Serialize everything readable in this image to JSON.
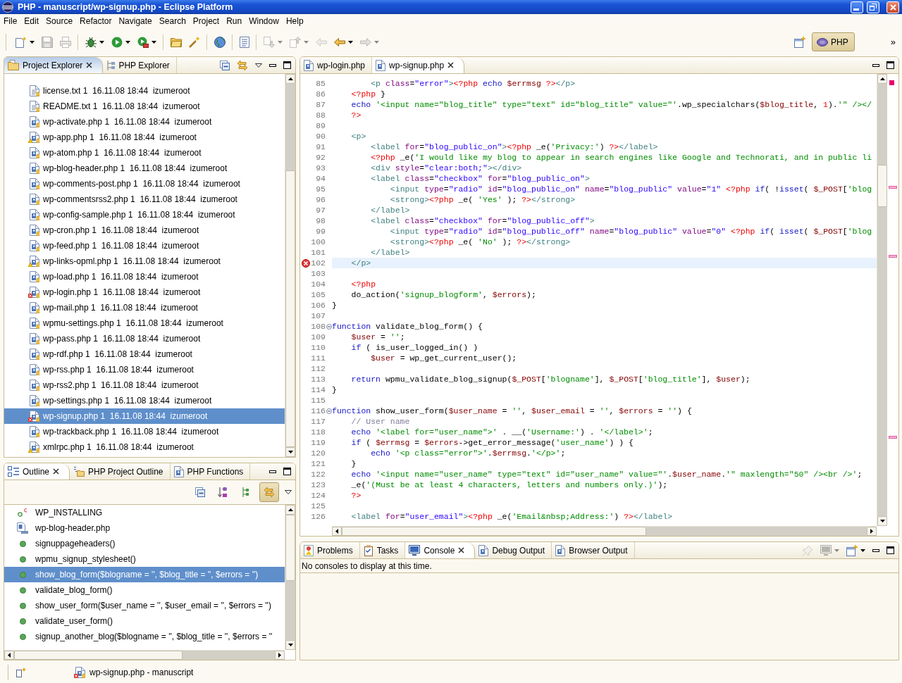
{
  "window": {
    "title": "PHP - manuscript/wp-signup.php - Eclipse Platform"
  },
  "menu": [
    "File",
    "Edit",
    "Source",
    "Refactor",
    "Navigate",
    "Search",
    "Project",
    "Run",
    "Window",
    "Help"
  ],
  "toolbar": {
    "buttons": [
      {
        "disabled": false,
        "dropdown": true
      },
      {
        "disabled": true,
        "dropdown": false
      },
      {
        "disabled": true,
        "dropdown": false
      },
      {
        "disabled": false,
        "dropdown": true
      },
      {
        "disabled": false,
        "dropdown": true
      },
      {
        "disabled": false,
        "dropdown": true
      },
      {
        "disabled": false,
        "dropdown": false
      },
      {
        "disabled": false,
        "dropdown": false
      },
      {
        "disabled": false,
        "dropdown": false
      },
      {
        "disabled": false,
        "dropdown": false
      },
      {
        "disabled": true,
        "dropdown": true
      },
      {
        "disabled": true,
        "dropdown": true
      },
      {
        "disabled": true,
        "dropdown": false
      },
      {
        "disabled": false,
        "dropdown": true
      },
      {
        "disabled": true,
        "dropdown": true
      }
    ],
    "perspectives": [
      {
        "label": "PHP",
        "selected": true
      }
    ],
    "overflow": "»"
  },
  "project_explorer": {
    "active": true,
    "tabs": [
      {
        "label": "Project Explorer",
        "selected": true
      },
      {
        "label": "PHP Explorer",
        "selected": false
      }
    ],
    "items": [
      {
        "name": "license.txt 1  16.11.08 18:44  izumeroot",
        "kind": "text",
        "selected": false
      },
      {
        "name": "README.txt 1  16.11.08 18:44  izumeroot",
        "kind": "text",
        "selected": false
      },
      {
        "name": "wp-activate.php 1  16.11.08 18:44  izumeroot",
        "kind": "php",
        "selected": false
      },
      {
        "name": "wp-app.php 1  16.11.08 18:44  izumeroot",
        "kind": "php-warning",
        "selected": false
      },
      {
        "name": "wp-atom.php 1  16.11.08 18:44  izumeroot",
        "kind": "php",
        "selected": false
      },
      {
        "name": "wp-blog-header.php 1  16.11.08 18:44  izumeroot",
        "kind": "php",
        "selected": false
      },
      {
        "name": "wp-comments-post.php 1  16.11.08 18:44  izumeroot",
        "kind": "php",
        "selected": false
      },
      {
        "name": "wp-commentsrss2.php 1  16.11.08 18:44  izumeroot",
        "kind": "php",
        "selected": false
      },
      {
        "name": "wp-config-sample.php 1  16.11.08 18:44  izumeroot",
        "kind": "php",
        "selected": false
      },
      {
        "name": "wp-cron.php 1  16.11.08 18:44  izumeroot",
        "kind": "php",
        "selected": false
      },
      {
        "name": "wp-feed.php 1  16.11.08 18:44  izumeroot",
        "kind": "php",
        "selected": false
      },
      {
        "name": "wp-links-opml.php 1  16.11.08 18:44  izumeroot",
        "kind": "php-warning",
        "selected": false
      },
      {
        "name": "wp-load.php 1  16.11.08 18:44  izumeroot",
        "kind": "php",
        "selected": false
      },
      {
        "name": "wp-login.php 1  16.11.08 18:44  izumeroot",
        "kind": "php-error",
        "selected": false
      },
      {
        "name": "wp-mail.php 1  16.11.08 18:44  izumeroot",
        "kind": "php",
        "selected": false
      },
      {
        "name": "wpmu-settings.php 1  16.11.08 18:44  izumeroot",
        "kind": "php",
        "selected": false
      },
      {
        "name": "wp-pass.php 1  16.11.08 18:44  izumeroot",
        "kind": "php",
        "selected": false
      },
      {
        "name": "wp-rdf.php 1  16.11.08 18:44  izumeroot",
        "kind": "php",
        "selected": false
      },
      {
        "name": "wp-rss.php 1  16.11.08 18:44  izumeroot",
        "kind": "php",
        "selected": false
      },
      {
        "name": "wp-rss2.php 1  16.11.08 18:44  izumeroot",
        "kind": "php",
        "selected": false
      },
      {
        "name": "wp-settings.php 1  16.11.08 18:44  izumeroot",
        "kind": "php",
        "selected": false
      },
      {
        "name": "wp-signup.php 1  16.11.08 18:44  izumeroot",
        "kind": "php-error",
        "selected": true
      },
      {
        "name": "wp-trackback.php 1  16.11.08 18:44  izumeroot",
        "kind": "php",
        "selected": false
      },
      {
        "name": "xmlrpc.php 1  16.11.08 18:44  izumeroot",
        "kind": "php-warning",
        "selected": false
      }
    ]
  },
  "outline": {
    "active": false,
    "tabs": [
      {
        "label": "Outline",
        "selected": true
      },
      {
        "label": "PHP Project Outline",
        "selected": false
      },
      {
        "label": "PHP Functions",
        "selected": false
      }
    ],
    "toolbar": [
      {
        "pressed": false
      },
      {
        "pressed": false
      },
      {
        "pressed": false
      },
      {
        "pressed": true
      }
    ],
    "items": [
      {
        "label": "WP_INSTALLING",
        "kind": "constant",
        "selected": false
      },
      {
        "label": "wp-blog-header.php",
        "kind": "include",
        "selected": false
      },
      {
        "label": "signuppageheaders()",
        "kind": "function",
        "selected": false
      },
      {
        "label": "wpmu_signup_stylesheet()",
        "kind": "function",
        "selected": false
      },
      {
        "label": "show_blog_form($blogname = '', $blog_title = '', $errors = '')",
        "kind": "function",
        "selected": true
      },
      {
        "label": "validate_blog_form()",
        "kind": "function",
        "selected": false
      },
      {
        "label": "show_user_form($user_name = '', $user_email = '', $errors = '')",
        "kind": "function",
        "selected": false
      },
      {
        "label": "validate_user_form()",
        "kind": "function",
        "selected": false
      },
      {
        "label": "signup_another_blog($blogname = '', $blog_title = '', $errors = ''",
        "kind": "function",
        "selected": false
      }
    ]
  },
  "editor": {
    "active": false,
    "tabs": [
      {
        "label": "wp-login.php",
        "selected": false
      },
      {
        "label": "wp-signup.php",
        "selected": true
      }
    ],
    "lines": [
      {
        "no": "85",
        "current": false,
        "error": false,
        "folding": false,
        "code": [
          {
            "kind": "tag",
            "text": "        <p "
          },
          {
            "kind": "attr",
            "text": "class"
          },
          {
            "kind": "plain",
            "text": "="
          },
          {
            "kind": "value",
            "text": "\"error\""
          },
          {
            "kind": "tag",
            "text": ">"
          },
          {
            "kind": "php",
            "text": "<?php "
          },
          {
            "kind": "keyword",
            "text": "echo "
          },
          {
            "kind": "variable",
            "text": "$errmsg "
          },
          {
            "kind": "php",
            "text": "?>"
          },
          {
            "kind": "tag",
            "text": "</p>"
          }
        ]
      },
      {
        "no": "86",
        "current": false,
        "error": false,
        "folding": false,
        "code": [
          {
            "kind": "php",
            "text": "    <?php"
          },
          {
            "kind": "plain",
            "text": " }"
          }
        ]
      },
      {
        "no": "87",
        "current": false,
        "error": false,
        "folding": false,
        "code": [
          {
            "kind": "keyword",
            "text": "    echo "
          },
          {
            "kind": "string",
            "text": "'<input name=\"blog_title\" type=\"text\" id=\"blog_title\" value=\"'"
          },
          {
            "kind": "plain",
            "text": ".wp_specialchars("
          },
          {
            "kind": "variable",
            "text": "$blog_title"
          },
          {
            "kind": "plain",
            "text": ", "
          },
          {
            "kind": "number",
            "text": "1"
          },
          {
            "kind": "plain",
            "text": ")."
          },
          {
            "kind": "string",
            "text": "'\" /></"
          }
        ]
      },
      {
        "no": "88",
        "current": false,
        "error": false,
        "folding": false,
        "code": [
          {
            "kind": "php",
            "text": "    ?>"
          }
        ]
      },
      {
        "no": "89",
        "current": false,
        "error": false,
        "folding": false
      },
      {
        "no": "90",
        "current": false,
        "error": false,
        "folding": false,
        "code": [
          {
            "kind": "tag",
            "text": "    <p>"
          }
        ]
      },
      {
        "no": "91",
        "current": false,
        "error": false,
        "folding": false,
        "code": [
          {
            "kind": "tag",
            "text": "        <label "
          },
          {
            "kind": "attr",
            "text": "for"
          },
          {
            "kind": "plain",
            "text": "="
          },
          {
            "kind": "value",
            "text": "\"blog_public_on\""
          },
          {
            "kind": "tag",
            "text": ">"
          },
          {
            "kind": "php",
            "text": "<?php"
          },
          {
            "kind": "plain",
            "text": " _e("
          },
          {
            "kind": "string",
            "text": "'Privacy:'"
          },
          {
            "kind": "plain",
            "text": ") "
          },
          {
            "kind": "php",
            "text": "?>"
          },
          {
            "kind": "tag",
            "text": "</label>"
          }
        ]
      },
      {
        "no": "92",
        "current": false,
        "error": false,
        "folding": false,
        "code": [
          {
            "kind": "php",
            "text": "        <?php"
          },
          {
            "kind": "plain",
            "text": " _e("
          },
          {
            "kind": "string",
            "text": "'I would like my blog to appear in search engines like Google and Technorati, and in public li"
          }
        ]
      },
      {
        "no": "93",
        "current": false,
        "error": false,
        "folding": false,
        "code": [
          {
            "kind": "tag",
            "text": "        <div "
          },
          {
            "kind": "attr",
            "text": "style"
          },
          {
            "kind": "plain",
            "text": "="
          },
          {
            "kind": "value",
            "text": "\"clear:both;\""
          },
          {
            "kind": "tag",
            "text": "></div>"
          }
        ]
      },
      {
        "no": "94",
        "current": false,
        "error": false,
        "folding": false,
        "code": [
          {
            "kind": "tag",
            "text": "        <label "
          },
          {
            "kind": "attr",
            "text": "class"
          },
          {
            "kind": "plain",
            "text": "="
          },
          {
            "kind": "value",
            "text": "\"checkbox\" "
          },
          {
            "kind": "attr",
            "text": "for"
          },
          {
            "kind": "plain",
            "text": "="
          },
          {
            "kind": "value",
            "text": "\"blog_public_on\""
          },
          {
            "kind": "tag",
            "text": ">"
          }
        ]
      },
      {
        "no": "95",
        "current": false,
        "error": false,
        "folding": false,
        "code": [
          {
            "kind": "tag",
            "text": "            <input "
          },
          {
            "kind": "attr",
            "text": "type"
          },
          {
            "kind": "plain",
            "text": "="
          },
          {
            "kind": "value",
            "text": "\"radio\" "
          },
          {
            "kind": "attr",
            "text": "id"
          },
          {
            "kind": "plain",
            "text": "="
          },
          {
            "kind": "value",
            "text": "\"blog_public_on\" "
          },
          {
            "kind": "attr",
            "text": "name"
          },
          {
            "kind": "plain",
            "text": "="
          },
          {
            "kind": "value",
            "text": "\"blog_public\" "
          },
          {
            "kind": "attr",
            "text": "value"
          },
          {
            "kind": "plain",
            "text": "="
          },
          {
            "kind": "value",
            "text": "\"1\" "
          },
          {
            "kind": "php",
            "text": "<?php "
          },
          {
            "kind": "keyword",
            "text": "if"
          },
          {
            "kind": "plain",
            "text": "( !"
          },
          {
            "kind": "keyword",
            "text": "isset"
          },
          {
            "kind": "plain",
            "text": "( "
          },
          {
            "kind": "variable",
            "text": "$_POST"
          },
          {
            "kind": "plain",
            "text": "["
          },
          {
            "kind": "string",
            "text": "'blog"
          }
        ]
      },
      {
        "no": "96",
        "current": false,
        "error": false,
        "folding": false,
        "code": [
          {
            "kind": "tag",
            "text": "            <strong>"
          },
          {
            "kind": "php",
            "text": "<?php"
          },
          {
            "kind": "plain",
            "text": " _e( "
          },
          {
            "kind": "string",
            "text": "'Yes'"
          },
          {
            "kind": "plain",
            "text": " ); "
          },
          {
            "kind": "php",
            "text": "?>"
          },
          {
            "kind": "tag",
            "text": "</strong>"
          }
        ]
      },
      {
        "no": "97",
        "current": false,
        "error": false,
        "folding": false,
        "code": [
          {
            "kind": "tag",
            "text": "        </label>"
          }
        ]
      },
      {
        "no": "98",
        "current": false,
        "error": false,
        "folding": false,
        "code": [
          {
            "kind": "tag",
            "text": "        <label "
          },
          {
            "kind": "attr",
            "text": "class"
          },
          {
            "kind": "plain",
            "text": "="
          },
          {
            "kind": "value",
            "text": "\"checkbox\" "
          },
          {
            "kind": "attr",
            "text": "for"
          },
          {
            "kind": "plain",
            "text": "="
          },
          {
            "kind": "value",
            "text": "\"blog_public_off\""
          },
          {
            "kind": "tag",
            "text": ">"
          }
        ]
      },
      {
        "no": "99",
        "current": false,
        "error": false,
        "folding": false,
        "code": [
          {
            "kind": "tag",
            "text": "            <input "
          },
          {
            "kind": "attr",
            "text": "type"
          },
          {
            "kind": "plain",
            "text": "="
          },
          {
            "kind": "value",
            "text": "\"radio\" "
          },
          {
            "kind": "attr",
            "text": "id"
          },
          {
            "kind": "plain",
            "text": "="
          },
          {
            "kind": "value",
            "text": "\"blog_public_off\" "
          },
          {
            "kind": "attr",
            "text": "name"
          },
          {
            "kind": "plain",
            "text": "="
          },
          {
            "kind": "value",
            "text": "\"blog_public\" "
          },
          {
            "kind": "attr",
            "text": "value"
          },
          {
            "kind": "plain",
            "text": "="
          },
          {
            "kind": "value",
            "text": "\"0\" "
          },
          {
            "kind": "php",
            "text": "<?php "
          },
          {
            "kind": "keyword",
            "text": "if"
          },
          {
            "kind": "plain",
            "text": "( "
          },
          {
            "kind": "keyword",
            "text": "isset"
          },
          {
            "kind": "plain",
            "text": "( "
          },
          {
            "kind": "variable",
            "text": "$_POST"
          },
          {
            "kind": "plain",
            "text": "["
          },
          {
            "kind": "string",
            "text": "'blog"
          }
        ]
      },
      {
        "no": "100",
        "current": false,
        "error": false,
        "folding": false,
        "code": [
          {
            "kind": "tag",
            "text": "            <strong>"
          },
          {
            "kind": "php",
            "text": "<?php"
          },
          {
            "kind": "plain",
            "text": " _e( "
          },
          {
            "kind": "string",
            "text": "'No'"
          },
          {
            "kind": "plain",
            "text": " ); "
          },
          {
            "kind": "php",
            "text": "?>"
          },
          {
            "kind": "tag",
            "text": "</strong>"
          }
        ]
      },
      {
        "no": "101",
        "current": false,
        "error": false,
        "folding": false,
        "code": [
          {
            "kind": "tag",
            "text": "        </label>"
          }
        ]
      },
      {
        "no": "102",
        "current": true,
        "error": true,
        "folding": false,
        "code": [
          {
            "kind": "tag",
            "text": "    </p>"
          }
        ]
      },
      {
        "no": "103",
        "current": false,
        "error": false,
        "folding": false
      },
      {
        "no": "104",
        "current": false,
        "error": false,
        "folding": false,
        "code": [
          {
            "kind": "php",
            "text": "    <?php"
          }
        ]
      },
      {
        "no": "105",
        "current": false,
        "error": false,
        "folding": false,
        "code": [
          {
            "kind": "plain",
            "text": "    do_action("
          },
          {
            "kind": "string",
            "text": "'signup_blogform'"
          },
          {
            "kind": "plain",
            "text": ", "
          },
          {
            "kind": "variable",
            "text": "$errors"
          },
          {
            "kind": "plain",
            "text": ");"
          }
        ]
      },
      {
        "no": "106",
        "current": false,
        "error": false,
        "folding": false,
        "code": [
          {
            "kind": "plain",
            "text": "}"
          }
        ]
      },
      {
        "no": "107",
        "current": false,
        "error": false,
        "folding": false
      },
      {
        "no": "108",
        "current": false,
        "error": false,
        "folding": true,
        "code": [
          {
            "kind": "keyword",
            "text": "function"
          },
          {
            "kind": "plain",
            "text": " validate_blog_form() {"
          }
        ]
      },
      {
        "no": "109",
        "current": false,
        "error": false,
        "folding": false,
        "code": [
          {
            "kind": "variable",
            "text": "    $user"
          },
          {
            "kind": "plain",
            "text": " = "
          },
          {
            "kind": "string",
            "text": "''"
          },
          {
            "kind": "plain",
            "text": ";"
          }
        ]
      },
      {
        "no": "110",
        "current": false,
        "error": false,
        "folding": false,
        "code": [
          {
            "kind": "keyword",
            "text": "    if"
          },
          {
            "kind": "plain",
            "text": " ( is_user_logged_in() )"
          }
        ]
      },
      {
        "no": "111",
        "current": false,
        "error": false,
        "folding": false,
        "code": [
          {
            "kind": "variable",
            "text": "        $user"
          },
          {
            "kind": "plain",
            "text": " = wp_get_current_user();"
          }
        ]
      },
      {
        "no": "112",
        "current": false,
        "error": false,
        "folding": false
      },
      {
        "no": "113",
        "current": false,
        "error": false,
        "folding": false,
        "code": [
          {
            "kind": "keyword",
            "text": "    return"
          },
          {
            "kind": "plain",
            "text": " wpmu_validate_blog_signup("
          },
          {
            "kind": "variable",
            "text": "$_POST"
          },
          {
            "kind": "plain",
            "text": "["
          },
          {
            "kind": "string",
            "text": "'blogname'"
          },
          {
            "kind": "plain",
            "text": "], "
          },
          {
            "kind": "variable",
            "text": "$_POST"
          },
          {
            "kind": "plain",
            "text": "["
          },
          {
            "kind": "string",
            "text": "'blog_title'"
          },
          {
            "kind": "plain",
            "text": "], "
          },
          {
            "kind": "variable",
            "text": "$user"
          },
          {
            "kind": "plain",
            "text": ");"
          }
        ]
      },
      {
        "no": "114",
        "current": false,
        "error": false,
        "folding": false,
        "code": [
          {
            "kind": "plain",
            "text": "}"
          }
        ]
      },
      {
        "no": "115",
        "current": false,
        "error": false,
        "folding": false
      },
      {
        "no": "116",
        "current": false,
        "error": false,
        "folding": true,
        "code": [
          {
            "kind": "keyword",
            "text": "function"
          },
          {
            "kind": "plain",
            "text": " show_user_form("
          },
          {
            "kind": "variable",
            "text": "$user_name"
          },
          {
            "kind": "plain",
            "text": " = "
          },
          {
            "kind": "string",
            "text": "''"
          },
          {
            "kind": "plain",
            "text": ", "
          },
          {
            "kind": "variable",
            "text": "$user_email"
          },
          {
            "kind": "plain",
            "text": " = "
          },
          {
            "kind": "string",
            "text": "''"
          },
          {
            "kind": "plain",
            "text": ", "
          },
          {
            "kind": "variable",
            "text": "$errors"
          },
          {
            "kind": "plain",
            "text": " = "
          },
          {
            "kind": "string",
            "text": "''"
          },
          {
            "kind": "plain",
            "text": ") {"
          }
        ]
      },
      {
        "no": "117",
        "current": false,
        "error": false,
        "folding": false,
        "code": [
          {
            "kind": "comment",
            "text": "    // User name"
          }
        ]
      },
      {
        "no": "118",
        "current": false,
        "error": false,
        "folding": false,
        "code": [
          {
            "kind": "keyword",
            "text": "    echo "
          },
          {
            "kind": "string",
            "text": "'<label for=\"user_name\">'"
          },
          {
            "kind": "plain",
            "text": " . __("
          },
          {
            "kind": "string",
            "text": "'Username:'"
          },
          {
            "kind": "plain",
            "text": ") . "
          },
          {
            "kind": "string",
            "text": "'</label>'"
          },
          {
            "kind": "plain",
            "text": ";"
          }
        ]
      },
      {
        "no": "119",
        "current": false,
        "error": false,
        "folding": false,
        "code": [
          {
            "kind": "keyword",
            "text": "    if"
          },
          {
            "kind": "plain",
            "text": " ( "
          },
          {
            "kind": "variable",
            "text": "$errmsg"
          },
          {
            "kind": "plain",
            "text": " = "
          },
          {
            "kind": "variable",
            "text": "$errors"
          },
          {
            "kind": "plain",
            "text": "->get_error_message("
          },
          {
            "kind": "string",
            "text": "'user_name'"
          },
          {
            "kind": "plain",
            "text": ") ) {"
          }
        ]
      },
      {
        "no": "120",
        "current": false,
        "error": false,
        "folding": false,
        "code": [
          {
            "kind": "keyword",
            "text": "        echo "
          },
          {
            "kind": "string",
            "text": "'<p class=\"error\">'"
          },
          {
            "kind": "plain",
            "text": "."
          },
          {
            "kind": "variable",
            "text": "$errmsg"
          },
          {
            "kind": "plain",
            "text": "."
          },
          {
            "kind": "string",
            "text": "'</p>'"
          },
          {
            "kind": "plain",
            "text": ";"
          }
        ]
      },
      {
        "no": "121",
        "current": false,
        "error": false,
        "folding": false,
        "code": [
          {
            "kind": "plain",
            "text": "    }"
          }
        ]
      },
      {
        "no": "122",
        "current": false,
        "error": false,
        "folding": false,
        "code": [
          {
            "kind": "keyword",
            "text": "    echo "
          },
          {
            "kind": "string",
            "text": "'<input name=\"user_name\" type=\"text\" id=\"user_name\" value=\"'"
          },
          {
            "kind": "plain",
            "text": "."
          },
          {
            "kind": "variable",
            "text": "$user_name"
          },
          {
            "kind": "plain",
            "text": "."
          },
          {
            "kind": "string",
            "text": "'\" maxlength=\"50\" /><br />'"
          },
          {
            "kind": "plain",
            "text": ";"
          }
        ]
      },
      {
        "no": "123",
        "current": false,
        "error": false,
        "folding": false,
        "code": [
          {
            "kind": "plain",
            "text": "    _e("
          },
          {
            "kind": "string",
            "text": "'(Must be at least 4 characters, letters and numbers only.)'"
          },
          {
            "kind": "plain",
            "text": ");"
          }
        ]
      },
      {
        "no": "124",
        "current": false,
        "error": false,
        "folding": false,
        "code": [
          {
            "kind": "php",
            "text": "    ?>"
          }
        ]
      },
      {
        "no": "125",
        "current": false,
        "error": false,
        "folding": false
      },
      {
        "no": "126",
        "current": false,
        "error": false,
        "folding": false,
        "code": [
          {
            "kind": "tag",
            "text": "    <label "
          },
          {
            "kind": "attr",
            "text": "for"
          },
          {
            "kind": "plain",
            "text": "="
          },
          {
            "kind": "value",
            "text": "\"user_email\""
          },
          {
            "kind": "tag",
            "text": ">"
          },
          {
            "kind": "php",
            "text": "<?php"
          },
          {
            "kind": "plain",
            "text": " _e("
          },
          {
            "kind": "string",
            "text": "'Email&nbsp;Address:'"
          },
          {
            "kind": "plain",
            "text": ") "
          },
          {
            "kind": "php",
            "text": "?>"
          },
          {
            "kind": "tag",
            "text": "</label>"
          }
        ]
      }
    ]
  },
  "console": {
    "active": false,
    "tabs": [
      {
        "label": "Problems",
        "selected": false
      },
      {
        "label": "Tasks",
        "selected": false
      },
      {
        "label": "Console",
        "selected": true
      },
      {
        "label": "Debug Output",
        "selected": false
      },
      {
        "label": "Browser Output",
        "selected": false
      }
    ],
    "toolbar": [
      {
        "disabled": true,
        "dropdown": false
      },
      {
        "disabled": true,
        "dropdown": true
      },
      {
        "disabled": false,
        "dropdown": true
      }
    ],
    "message": "No consoles to display at this time."
  },
  "status_bar": {
    "text": "wp-signup.php - manuscript"
  }
}
